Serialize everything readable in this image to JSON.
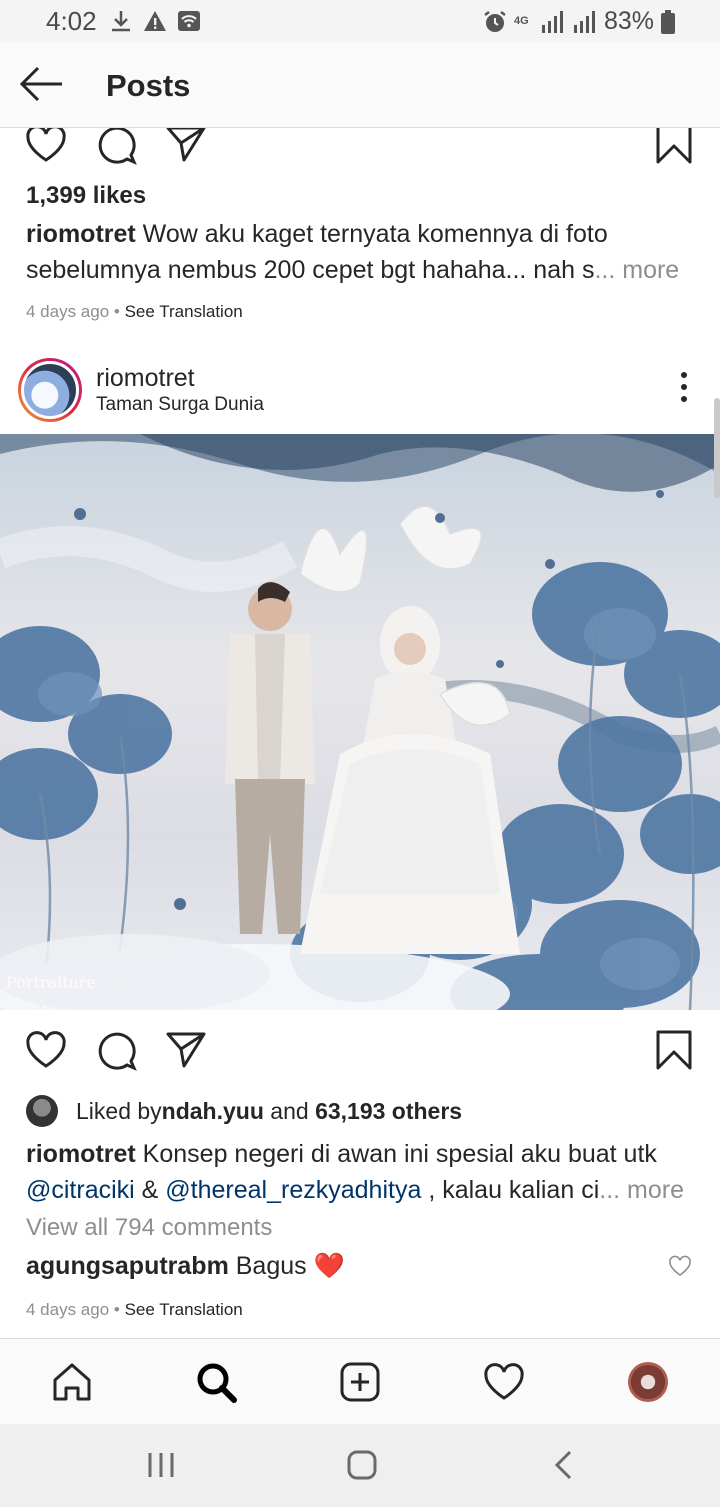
{
  "status_bar": {
    "time": "4:02",
    "battery": "83%",
    "network": "4G",
    "icons": [
      "download-icon",
      "warning-icon",
      "wifi-icon",
      "alarm-icon",
      "signal-icon",
      "battery-icon"
    ]
  },
  "header": {
    "title": "Posts",
    "back_icon": "arrow-left-icon"
  },
  "previous_post": {
    "likes": "1,399 likes",
    "caption_user": "riomotret",
    "caption_text": " Wow aku kaget ternyata komennya di foto sebelumnya nembus 200 cepet bgt hahaha... nah s",
    "more": "... more",
    "time_ago": "4 days ago",
    "separator": " • ",
    "see_translation": "See Translation"
  },
  "post": {
    "username": "riomotret",
    "location": "Taman Surga Dunia",
    "watermark": "Portraiture",
    "liked_by_prefix": "Liked by ",
    "liked_by_user": "ndah.yuu",
    "liked_by_middle": " and ",
    "liked_by_others": "63,193 others",
    "caption_user": "riomotret",
    "caption_text": " Konsep negeri di awan ini spesial aku buat utk",
    "mention_1": "@citraciki",
    "amp": " & ",
    "mention_2": "@thereal_rezkyadhitya",
    "caption_rest": " , kalau kalian ci",
    "more": "... more",
    "view_all_comments": "View all 794 comments",
    "comment_user": "agungsaputrabm",
    "comment_text": " Bagus ",
    "comment_emoji": "❤️",
    "time_ago": "4 days ago",
    "separator": " • ",
    "see_translation": "See Translation"
  },
  "tab_bar": {
    "items": [
      "home-icon",
      "search-icon",
      "add-post-icon",
      "activity-heart-icon",
      "profile-avatar"
    ]
  },
  "system_nav": {
    "items": [
      "recent-apps-icon",
      "home-button-icon",
      "back-button-icon"
    ]
  }
}
